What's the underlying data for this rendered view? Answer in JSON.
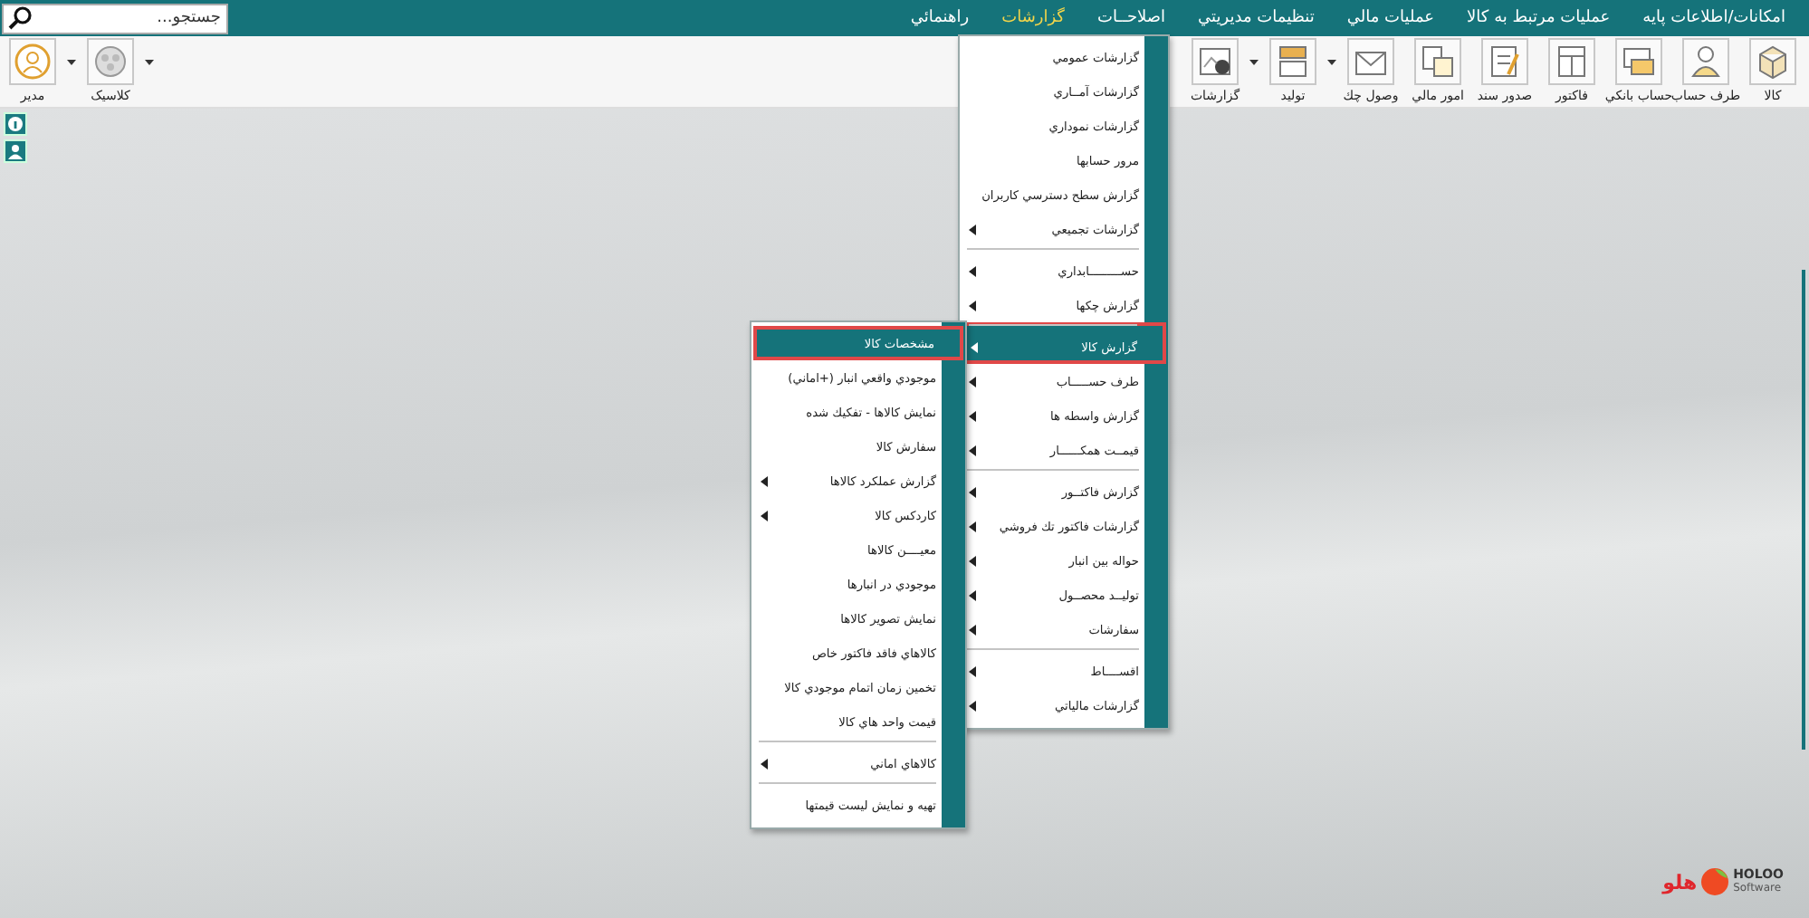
{
  "menubar": {
    "items": [
      {
        "label": "امکانات/اطلاعات پايه",
        "selected": false
      },
      {
        "label": "عمليات مرتبط به کالا",
        "selected": false
      },
      {
        "label": "عمليات مالي",
        "selected": false
      },
      {
        "label": "تنظيمات مديريتي",
        "selected": false
      },
      {
        "label": "اصلاحــات",
        "selected": false
      },
      {
        "label": "گزارشات",
        "selected": true
      },
      {
        "label": "راهنمائي",
        "selected": false
      }
    ],
    "search": {
      "placeholder": "جستجو..."
    }
  },
  "toolbar": {
    "right_group": [
      {
        "label": "کالا",
        "dropdown": false
      },
      {
        "label": "طرف حساب",
        "dropdown": false
      },
      {
        "label": "حساب بانکي",
        "dropdown": false
      },
      {
        "label": "فاکتور",
        "dropdown": false
      },
      {
        "label": "صدور سند",
        "dropdown": false
      },
      {
        "label": "امور مالي",
        "dropdown": false
      },
      {
        "label": "وصول چك",
        "dropdown": false
      },
      {
        "label": "توليد",
        "dropdown": true
      },
      {
        "label": "گزارشات",
        "dropdown": true
      }
    ],
    "left_group": [
      {
        "label": "کلاسيک",
        "dropdown": true
      },
      {
        "label": "مدير",
        "dropdown": true
      }
    ]
  },
  "reports_menu": {
    "items": [
      {
        "label": "گزارشات عمومي",
        "submenu": false,
        "separator_before": false,
        "selected": false
      },
      {
        "label": "گزارشات آمــاري",
        "submenu": false,
        "separator_before": false,
        "selected": false
      },
      {
        "label": "گزارشات نموداري",
        "submenu": false,
        "separator_before": false,
        "selected": false
      },
      {
        "label": "مرور حسابها",
        "submenu": false,
        "separator_before": false,
        "selected": false
      },
      {
        "label": "گزارش سطح دسترسي کاربران",
        "submenu": false,
        "separator_before": false,
        "selected": false
      },
      {
        "label": "گزارشات تجميعي",
        "submenu": true,
        "separator_before": false,
        "selected": false
      },
      {
        "label": "حســـــــــابداري",
        "submenu": true,
        "separator_before": true,
        "selected": false
      },
      {
        "label": "گزارش چکها",
        "submenu": true,
        "separator_before": false,
        "selected": false
      },
      {
        "label": "گزارش کالا",
        "submenu": true,
        "separator_before": true,
        "selected": true,
        "children": [
          {
            "label": "مشخصات کالا",
            "submenu": false,
            "separator_before": false,
            "selected": true
          },
          {
            "label": "موجودي واقعي انبار (+اماني)",
            "submenu": false,
            "separator_before": false,
            "selected": false
          },
          {
            "label": "نمايش کالاها - تفکيك شده",
            "submenu": false,
            "separator_before": false,
            "selected": false
          },
          {
            "label": "سفارش کالا",
            "submenu": false,
            "separator_before": false,
            "selected": false
          },
          {
            "label": "گزارش عملکرد کالاها",
            "submenu": true,
            "separator_before": false,
            "selected": false
          },
          {
            "label": "کاردکس کالا",
            "submenu": true,
            "separator_before": false,
            "selected": false
          },
          {
            "label": "معيــــن کالاها",
            "submenu": false,
            "separator_before": false,
            "selected": false
          },
          {
            "label": "موجودي در انبارها",
            "submenu": false,
            "separator_before": false,
            "selected": false
          },
          {
            "label": "نمايش تصوير کالاها",
            "submenu": false,
            "separator_before": false,
            "selected": false
          },
          {
            "label": "کالاهاي فاقد فاکتور خاص",
            "submenu": false,
            "separator_before": false,
            "selected": false
          },
          {
            "label": "تخمين زمان اتمام موجودي کالا",
            "submenu": false,
            "separator_before": false,
            "selected": false
          },
          {
            "label": "قيمت واحد هاي کالا",
            "submenu": false,
            "separator_before": false,
            "selected": false
          },
          {
            "label": "کالاهاي اماني",
            "submenu": true,
            "separator_before": true,
            "selected": false
          },
          {
            "label": "تهيه و نمايش ليست قيمتها",
            "submenu": false,
            "separator_before": true,
            "selected": false
          }
        ]
      },
      {
        "label": "طرف حســـــاب",
        "submenu": true,
        "separator_before": false,
        "selected": false
      },
      {
        "label": "گزارش واسطه ها",
        "submenu": true,
        "separator_before": false,
        "selected": false
      },
      {
        "label": "قيمــت همکــــــار",
        "submenu": true,
        "separator_before": false,
        "selected": false
      },
      {
        "label": "گزارش فاکتــور",
        "submenu": true,
        "separator_before": true,
        "selected": false
      },
      {
        "label": "گزارشات فاکتور تك فروشي",
        "submenu": true,
        "separator_before": false,
        "selected": false
      },
      {
        "label": "حواله بين انبار",
        "submenu": true,
        "separator_before": false,
        "selected": false
      },
      {
        "label": "توليــد محصــول",
        "submenu": true,
        "separator_before": false,
        "selected": false
      },
      {
        "label": "سفارشات",
        "submenu": true,
        "separator_before": false,
        "selected": false
      },
      {
        "label": "اقســــاط",
        "submenu": true,
        "separator_before": true,
        "selected": false
      },
      {
        "label": "گزارشات مالياتي",
        "submenu": true,
        "separator_before": false,
        "selected": false
      }
    ]
  },
  "logo": {
    "persian": "هلو",
    "brand": "HOLOO",
    "tagline": "Software"
  }
}
